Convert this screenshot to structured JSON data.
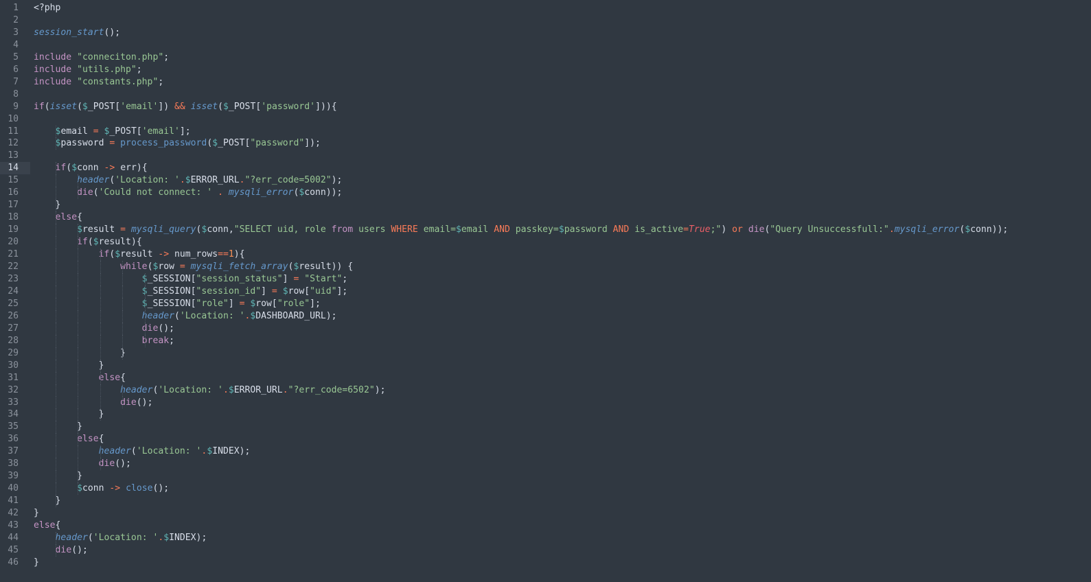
{
  "editor": {
    "active_line": 14,
    "theme_colors": {
      "background": "#303841",
      "plain": "#d8dee9",
      "keyword": "#c594c5",
      "function": "#6699cc",
      "string": "#99c794",
      "variable": "#5fb3b3",
      "operator": "#f97b58",
      "number": "#f99157",
      "constant": "#ec5f67"
    },
    "lines": [
      [
        [
          "plain",
          "<?php"
        ]
      ],
      [],
      [
        [
          "fn",
          "session_start"
        ],
        [
          "punc",
          "();"
        ]
      ],
      [],
      [
        [
          "kw",
          "include"
        ],
        [
          "plain",
          " "
        ],
        [
          "str",
          "\"conneciton.php\""
        ],
        [
          "punc",
          ";"
        ]
      ],
      [
        [
          "kw",
          "include"
        ],
        [
          "plain",
          " "
        ],
        [
          "str",
          "\"utils.php\""
        ],
        [
          "punc",
          ";"
        ]
      ],
      [
        [
          "kw",
          "include"
        ],
        [
          "plain",
          " "
        ],
        [
          "str",
          "\"constants.php\""
        ],
        [
          "punc",
          ";"
        ]
      ],
      [],
      [
        [
          "kw",
          "if"
        ],
        [
          "punc",
          "("
        ],
        [
          "fn",
          "isset"
        ],
        [
          "punc",
          "("
        ],
        [
          "var",
          "$"
        ],
        [
          "plain",
          "_POST["
        ],
        [
          "str",
          "'email'"
        ],
        [
          "plain",
          "]) "
        ],
        [
          "op",
          "&&"
        ],
        [
          "plain",
          " "
        ],
        [
          "fn",
          "isset"
        ],
        [
          "punc",
          "("
        ],
        [
          "var",
          "$"
        ],
        [
          "plain",
          "_POST["
        ],
        [
          "str",
          "'password'"
        ],
        [
          "plain",
          "])){"
        ]
      ],
      [],
      [
        [
          "plain",
          "    "
        ],
        [
          "var",
          "$"
        ],
        [
          "plain",
          "email "
        ],
        [
          "op",
          "="
        ],
        [
          "plain",
          " "
        ],
        [
          "var",
          "$"
        ],
        [
          "plain",
          "_POST["
        ],
        [
          "str",
          "'email'"
        ],
        [
          "plain",
          "];"
        ]
      ],
      [
        [
          "plain",
          "    "
        ],
        [
          "var",
          "$"
        ],
        [
          "plain",
          "password "
        ],
        [
          "op",
          "="
        ],
        [
          "plain",
          " "
        ],
        [
          "method",
          "process_password"
        ],
        [
          "punc",
          "("
        ],
        [
          "var",
          "$"
        ],
        [
          "plain",
          "_POST["
        ],
        [
          "str",
          "\"password\""
        ],
        [
          "plain",
          "]);"
        ]
      ],
      [],
      [
        [
          "plain",
          "    "
        ],
        [
          "kw",
          "if"
        ],
        [
          "punc",
          "("
        ],
        [
          "var",
          "$"
        ],
        [
          "plain",
          "conn "
        ],
        [
          "op",
          "->"
        ],
        [
          "plain",
          " err){"
        ]
      ],
      [
        [
          "plain",
          "        "
        ],
        [
          "fn",
          "header"
        ],
        [
          "punc",
          "("
        ],
        [
          "str",
          "'Location: '"
        ],
        [
          "op",
          "."
        ],
        [
          "var",
          "$"
        ],
        [
          "plain",
          "ERROR_URL"
        ],
        [
          "op",
          "."
        ],
        [
          "str",
          "\"?err_code=5002\""
        ],
        [
          "punc",
          ");"
        ]
      ],
      [
        [
          "plain",
          "        "
        ],
        [
          "kw",
          "die"
        ],
        [
          "punc",
          "("
        ],
        [
          "str",
          "'Could not connect: '"
        ],
        [
          "plain",
          " "
        ],
        [
          "op",
          "."
        ],
        [
          "plain",
          " "
        ],
        [
          "fn",
          "mysqli_error"
        ],
        [
          "punc",
          "("
        ],
        [
          "var",
          "$"
        ],
        [
          "plain",
          "conn));"
        ]
      ],
      [
        [
          "plain",
          "    }"
        ]
      ],
      [
        [
          "plain",
          "    "
        ],
        [
          "kw",
          "else"
        ],
        [
          "plain",
          "{"
        ]
      ],
      [
        [
          "plain",
          "        "
        ],
        [
          "var",
          "$"
        ],
        [
          "plain",
          "result "
        ],
        [
          "op",
          "="
        ],
        [
          "plain",
          " "
        ],
        [
          "fn",
          "mysqli_query"
        ],
        [
          "punc",
          "("
        ],
        [
          "var",
          "$"
        ],
        [
          "plain",
          "conn,"
        ],
        [
          "str",
          "\"SELECT uid, role "
        ],
        [
          "kw",
          "from"
        ],
        [
          "str",
          " users "
        ],
        [
          "op",
          "WHERE"
        ],
        [
          "str",
          " email="
        ],
        [
          "var",
          "$"
        ],
        [
          "str",
          "email "
        ],
        [
          "op",
          "AND"
        ],
        [
          "str",
          " passkey="
        ],
        [
          "var",
          "$"
        ],
        [
          "str",
          "password "
        ],
        [
          "op",
          "AND"
        ],
        [
          "str",
          " is_active"
        ],
        [
          "op",
          "="
        ],
        [
          "const",
          "True"
        ],
        [
          "str",
          ";\""
        ],
        [
          "punc",
          ")"
        ],
        [
          "plain",
          " "
        ],
        [
          "op",
          "or"
        ],
        [
          "plain",
          " "
        ],
        [
          "kw",
          "die"
        ],
        [
          "punc",
          "("
        ],
        [
          "str",
          "\"Query Unsuccessfull:\""
        ],
        [
          "op",
          "."
        ],
        [
          "fn",
          "mysqli_error"
        ],
        [
          "punc",
          "("
        ],
        [
          "var",
          "$"
        ],
        [
          "plain",
          "conn));"
        ]
      ],
      [
        [
          "plain",
          "        "
        ],
        [
          "kw",
          "if"
        ],
        [
          "punc",
          "("
        ],
        [
          "var",
          "$"
        ],
        [
          "plain",
          "result){"
        ]
      ],
      [
        [
          "plain",
          "            "
        ],
        [
          "kw",
          "if"
        ],
        [
          "punc",
          "("
        ],
        [
          "var",
          "$"
        ],
        [
          "plain",
          "result "
        ],
        [
          "op",
          "->"
        ],
        [
          "plain",
          " num_rows"
        ],
        [
          "op",
          "=="
        ],
        [
          "num",
          "1"
        ],
        [
          "plain",
          "){"
        ]
      ],
      [
        [
          "plain",
          "                "
        ],
        [
          "kw",
          "while"
        ],
        [
          "punc",
          "("
        ],
        [
          "var",
          "$"
        ],
        [
          "plain",
          "row "
        ],
        [
          "op",
          "="
        ],
        [
          "plain",
          " "
        ],
        [
          "fn",
          "mysqli_fetch_array"
        ],
        [
          "punc",
          "("
        ],
        [
          "var",
          "$"
        ],
        [
          "plain",
          "result)) {"
        ]
      ],
      [
        [
          "plain",
          "                    "
        ],
        [
          "var",
          "$"
        ],
        [
          "plain",
          "_SESSION["
        ],
        [
          "str",
          "\"session_status\""
        ],
        [
          "plain",
          "] "
        ],
        [
          "op",
          "="
        ],
        [
          "plain",
          " "
        ],
        [
          "str",
          "\"Start\""
        ],
        [
          "punc",
          ";"
        ]
      ],
      [
        [
          "plain",
          "                    "
        ],
        [
          "var",
          "$"
        ],
        [
          "plain",
          "_SESSION["
        ],
        [
          "str",
          "\"session_id\""
        ],
        [
          "plain",
          "] "
        ],
        [
          "op",
          "="
        ],
        [
          "plain",
          " "
        ],
        [
          "var",
          "$"
        ],
        [
          "plain",
          "row["
        ],
        [
          "str",
          "\"uid\""
        ],
        [
          "plain",
          "];"
        ]
      ],
      [
        [
          "plain",
          "                    "
        ],
        [
          "var",
          "$"
        ],
        [
          "plain",
          "_SESSION["
        ],
        [
          "str",
          "\"role\""
        ],
        [
          "plain",
          "] "
        ],
        [
          "op",
          "="
        ],
        [
          "plain",
          " "
        ],
        [
          "var",
          "$"
        ],
        [
          "plain",
          "row["
        ],
        [
          "str",
          "\"role\""
        ],
        [
          "plain",
          "];"
        ]
      ],
      [
        [
          "plain",
          "                    "
        ],
        [
          "fn",
          "header"
        ],
        [
          "punc",
          "("
        ],
        [
          "str",
          "'Location: '"
        ],
        [
          "op",
          "."
        ],
        [
          "var",
          "$"
        ],
        [
          "plain",
          "DASHBOARD_URL);"
        ]
      ],
      [
        [
          "plain",
          "                    "
        ],
        [
          "kw",
          "die"
        ],
        [
          "punc",
          "();"
        ]
      ],
      [
        [
          "plain",
          "                    "
        ],
        [
          "kw",
          "break"
        ],
        [
          "punc",
          ";"
        ]
      ],
      [
        [
          "plain",
          "                }"
        ]
      ],
      [
        [
          "plain",
          "            }"
        ]
      ],
      [
        [
          "plain",
          "            "
        ],
        [
          "kw",
          "else"
        ],
        [
          "plain",
          "{"
        ]
      ],
      [
        [
          "plain",
          "                "
        ],
        [
          "fn",
          "header"
        ],
        [
          "punc",
          "("
        ],
        [
          "str",
          "'Location: '"
        ],
        [
          "op",
          "."
        ],
        [
          "var",
          "$"
        ],
        [
          "plain",
          "ERROR_URL"
        ],
        [
          "op",
          "."
        ],
        [
          "str",
          "\"?err_code=6502\""
        ],
        [
          "punc",
          ");"
        ]
      ],
      [
        [
          "plain",
          "                "
        ],
        [
          "kw",
          "die"
        ],
        [
          "punc",
          "();"
        ]
      ],
      [
        [
          "plain",
          "            }"
        ]
      ],
      [
        [
          "plain",
          "        }"
        ]
      ],
      [
        [
          "plain",
          "        "
        ],
        [
          "kw",
          "else"
        ],
        [
          "plain",
          "{"
        ]
      ],
      [
        [
          "plain",
          "            "
        ],
        [
          "fn",
          "header"
        ],
        [
          "punc",
          "("
        ],
        [
          "str",
          "'Location: '"
        ],
        [
          "op",
          "."
        ],
        [
          "var",
          "$"
        ],
        [
          "plain",
          "INDEX);"
        ]
      ],
      [
        [
          "plain",
          "            "
        ],
        [
          "kw",
          "die"
        ],
        [
          "punc",
          "();"
        ]
      ],
      [
        [
          "plain",
          "        }"
        ]
      ],
      [
        [
          "plain",
          "        "
        ],
        [
          "var",
          "$"
        ],
        [
          "plain",
          "conn "
        ],
        [
          "op",
          "->"
        ],
        [
          "plain",
          " "
        ],
        [
          "method",
          "close"
        ],
        [
          "punc",
          "();"
        ]
      ],
      [
        [
          "plain",
          "    }"
        ]
      ],
      [
        [
          "plain",
          "}"
        ]
      ],
      [
        [
          "kw",
          "else"
        ],
        [
          "plain",
          "{"
        ]
      ],
      [
        [
          "plain",
          "    "
        ],
        [
          "fn",
          "header"
        ],
        [
          "punc",
          "("
        ],
        [
          "str",
          "'Location: '"
        ],
        [
          "op",
          "."
        ],
        [
          "var",
          "$"
        ],
        [
          "plain",
          "INDEX);"
        ]
      ],
      [
        [
          "plain",
          "    "
        ],
        [
          "kw",
          "die"
        ],
        [
          "punc",
          "();"
        ]
      ],
      [
        [
          "plain",
          "}"
        ]
      ]
    ]
  }
}
